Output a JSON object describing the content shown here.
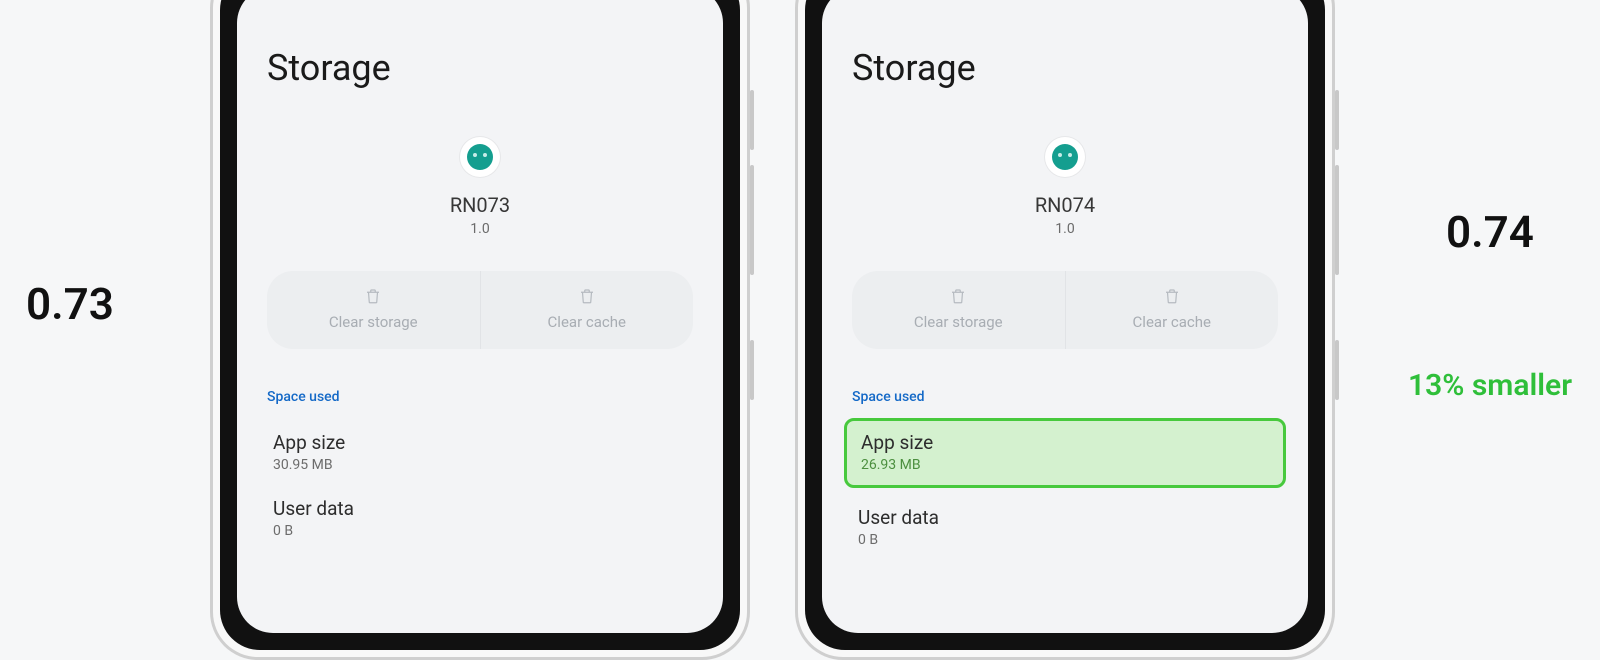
{
  "left_version": "0.73",
  "right_version": "0.74",
  "smaller_text": "13% smaller",
  "screen": {
    "title": "Storage",
    "clear_storage": "Clear storage",
    "clear_cache": "Clear cache",
    "space_used": "Space used",
    "app_size_label": "App size",
    "user_data_label": "User data"
  },
  "phones": {
    "a": {
      "app_name": "RN073",
      "app_version": "1.0",
      "app_size": "30.95 MB",
      "user_data": "0 B"
    },
    "b": {
      "app_name": "RN074",
      "app_version": "1.0",
      "app_size": "26.93 MB",
      "user_data": "0 B"
    }
  }
}
